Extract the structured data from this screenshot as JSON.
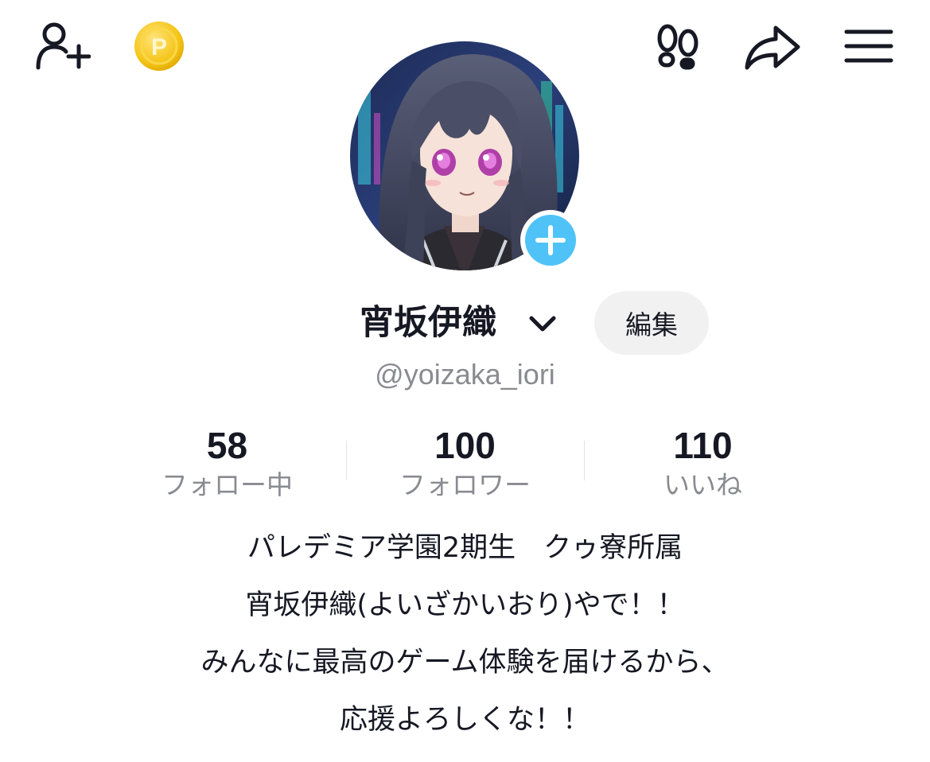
{
  "header": {
    "icons": [
      "add-friend-icon",
      "coin-icon",
      "footprints-icon",
      "share-icon",
      "menu-icon"
    ],
    "coin_letter": "P"
  },
  "profile": {
    "display_name": "宵坂伊織",
    "edit_label": "編集",
    "username": "@yoizaka_iori",
    "avatar_plus_color": "#4fc3f7"
  },
  "stats": [
    {
      "value": "58",
      "label": "フォロー中"
    },
    {
      "value": "100",
      "label": "フォロワー"
    },
    {
      "value": "110",
      "label": "いいね"
    }
  ],
  "bio": {
    "lines": [
      "パレデミア学園2期生　クゥ寮所属",
      "宵坂伊織(よいざかいおり)やで！！",
      "みんなに最高のゲーム体験を届けるから、",
      "応援よろしくな！！"
    ]
  },
  "colors": {
    "text": "#161823",
    "muted": "#8a8b91",
    "button_bg": "#f1f1f2",
    "coin": "#f5c518",
    "accent": "#4fc3f7"
  }
}
